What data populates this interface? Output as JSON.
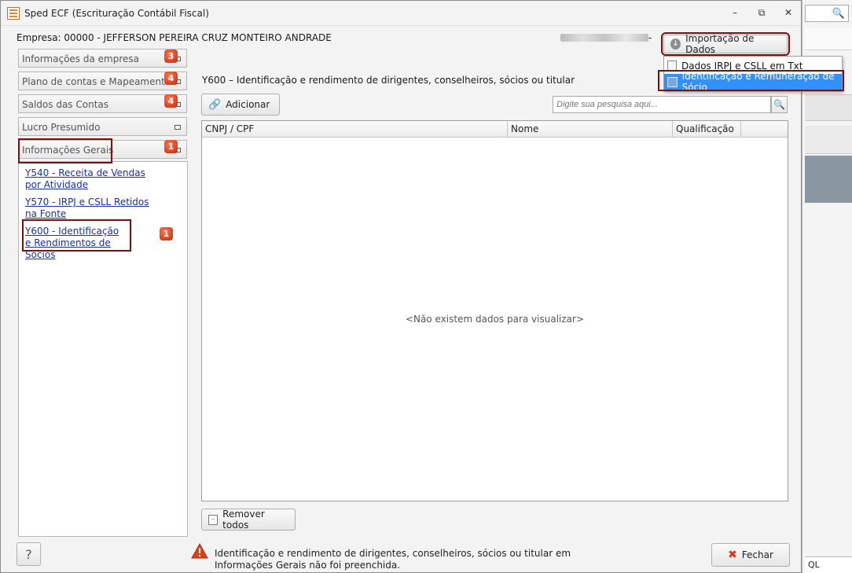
{
  "window": {
    "title": "Sped ECF (Escrituração Contábil Fiscal)"
  },
  "header": {
    "empresa": "Empresa: 00000 - JEFFERSON PEREIRA CRUZ MONTEIRO ANDRADE",
    "masked_suffix": "-"
  },
  "importacao": {
    "button_label": "Importação de Dados",
    "menu": [
      {
        "label": "Dados IRPJ e CSLL em Txt",
        "icon": "document-icon"
      },
      {
        "label": "Identificação e Remuneração de Sócio",
        "icon": "person-card-icon"
      }
    ]
  },
  "sidebar": {
    "sections": [
      {
        "label": "Informações da empresa",
        "badge": "3"
      },
      {
        "label": "Plano de contas e Mapeamento",
        "badge": "4"
      },
      {
        "label": "Saldos das Contas",
        "badge": "4"
      },
      {
        "label": "Lucro Presumido",
        "badge": ""
      },
      {
        "label": "Informações Gerais",
        "badge": "1"
      }
    ],
    "links": [
      {
        "label": "Y540 - Receita de Vendas por Atividade"
      },
      {
        "label": "Y570 - IRPJ e CSLL Retidos na Fonte"
      },
      {
        "label": "Y600 - Identificação e Rendimentos de Sócios",
        "badge": "1"
      }
    ]
  },
  "main": {
    "title": "Y600 – Identificação e rendimento de dirigentes, conselheiros, sócios ou titular",
    "add_label": "Adicionar",
    "search_placeholder": "Digite sua pesquisa aqui...",
    "columns": [
      "CNPJ / CPF",
      "Nome",
      "Qualificação"
    ],
    "empty_message": "<Não existem dados para visualizar>",
    "remove_all_label": "Remover todos"
  },
  "footer": {
    "help_label": "?",
    "warning_text": "Identificação e rendimento de dirigentes, conselheiros, sócios ou titular em Informações Gerais não foi preenchida.",
    "close_label": "Fechar"
  },
  "background_app": {
    "bottom_text": "QL"
  },
  "colors": {
    "highlight": "#7a1010",
    "badge": "#cc2200",
    "link": "#1a30a8",
    "menu_selected": "#3390ff"
  }
}
